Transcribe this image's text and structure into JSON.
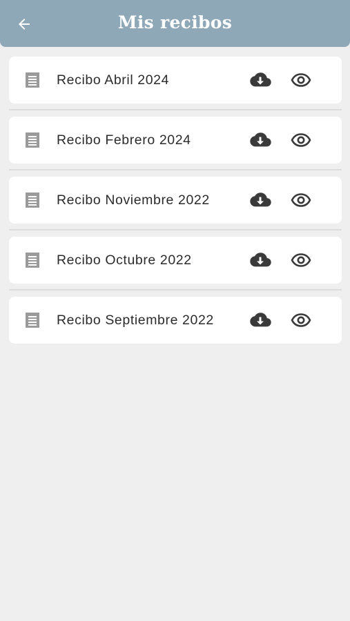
{
  "header": {
    "title": "Mis recibos",
    "back_icon": "arrow-left-icon",
    "background": "#8fa8b8"
  },
  "receipts": [
    {
      "label": "Recibo Abril 2024"
    },
    {
      "label": "Recibo Febrero 2024"
    },
    {
      "label": "Recibo Noviembre 2022"
    },
    {
      "label": "Recibo Octubre 2022"
    },
    {
      "label": "Recibo Septiembre 2022"
    }
  ],
  "icons": {
    "document": "document-icon",
    "download": "cloud-download-icon",
    "view": "eye-icon"
  },
  "colors": {
    "page_background": "#efefef",
    "card_background": "#ffffff",
    "icon_dark": "#3a3a3a",
    "icon_muted": "#9a9a9a"
  }
}
